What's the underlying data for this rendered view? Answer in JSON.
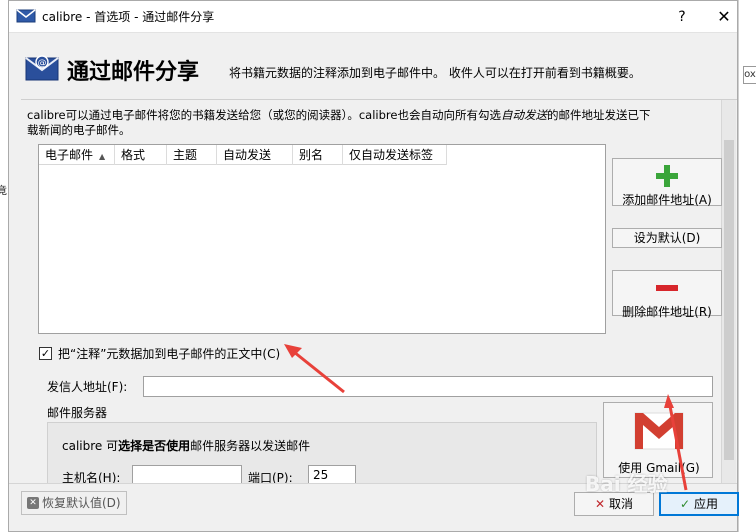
{
  "window": {
    "title": "calibre - 首选项 - 通过邮件分享",
    "help": "?",
    "close": "✕"
  },
  "header": {
    "heading": "通过邮件分享",
    "subtitle": "将书籍元数据的注释添加到电子邮件中。 收件人可以在打开前看到书籍概要。"
  },
  "background": {
    "right_fragment": "ox",
    "left_fragment": "竟"
  },
  "intro": {
    "before": "calibre可以通过电子邮件将您的书籍发送给您（或您的阅读器）。calibre也会自动向所有勾选",
    "emphasis": "自动发送",
    "after": "的邮件地址发送已下载新闻的电子邮件。"
  },
  "table": {
    "columns": [
      "电子邮件",
      "格式",
      "主题",
      "自动发送",
      "别名",
      "仅自动发送标签"
    ],
    "sort_indicator": "▲",
    "rows": []
  },
  "buttons": {
    "add_email": "添加邮件地址(A)",
    "set_default": "设为默认(D)",
    "remove_email": "删除邮件地址(R)",
    "gmail": "使用 Gmail(G)",
    "restore_defaults": "恢复默认值(D)",
    "cancel": "取消",
    "apply": "应用"
  },
  "options": {
    "add_comments_label": "把“注释”元数据加到电子邮件的正文中(C)",
    "add_comments_checked": "✓"
  },
  "form": {
    "from_label": "发信人地址(F):",
    "from_value": "",
    "server_section": "邮件服务器",
    "server_desc_pre": "calibre 可",
    "server_desc_bold": "选择是否使用",
    "server_desc_post": "邮件服务器以发送邮件",
    "host_label": "主机名(H):",
    "host_value": "",
    "port_label": "端口(P):",
    "port_value": "25"
  },
  "watermark": "Bai 经验",
  "colors": {
    "accent": "#0078d7",
    "arrow": "#e8413a",
    "add_green": "#3aa53a",
    "remove_red": "#d7262b"
  }
}
